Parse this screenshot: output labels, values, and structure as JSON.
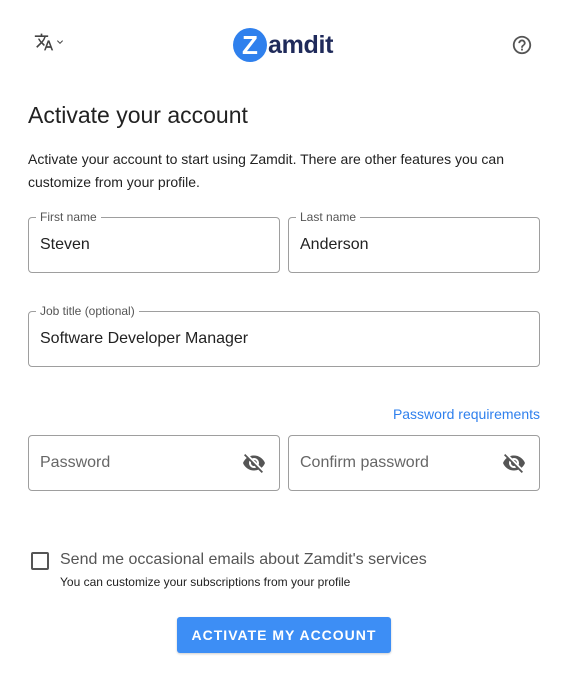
{
  "header": {
    "logo_letter": "Z",
    "logo_text": "amdit",
    "language_icon": "translate-icon",
    "help_icon": "help-circle-icon"
  },
  "page": {
    "title": "Activate your account",
    "description": "Activate your account to start using Zamdit. There are other features you can customize from your profile."
  },
  "form": {
    "first_name": {
      "label": "First name",
      "value": "Steven"
    },
    "last_name": {
      "label": "Last name",
      "value": "Anderson"
    },
    "job_title": {
      "label": "Job title (optional)",
      "value": "Software Developer Manager"
    },
    "password_requirements_link": "Password requirements",
    "password": {
      "placeholder": "Password",
      "icon": "eye-off-icon"
    },
    "confirm_password": {
      "placeholder": "Confirm password",
      "icon": "eye-off-icon"
    },
    "emails_checkbox": {
      "label": "Send me occasional emails about Zamdit's services",
      "sublabel": "You can customize your subscriptions from your profile",
      "checked": false
    },
    "submit_label": "ACTIVATE MY ACCOUNT"
  },
  "colors": {
    "accent": "#3d8ef5",
    "link": "#2f80ed",
    "logo_dark": "#1f2a5a"
  }
}
